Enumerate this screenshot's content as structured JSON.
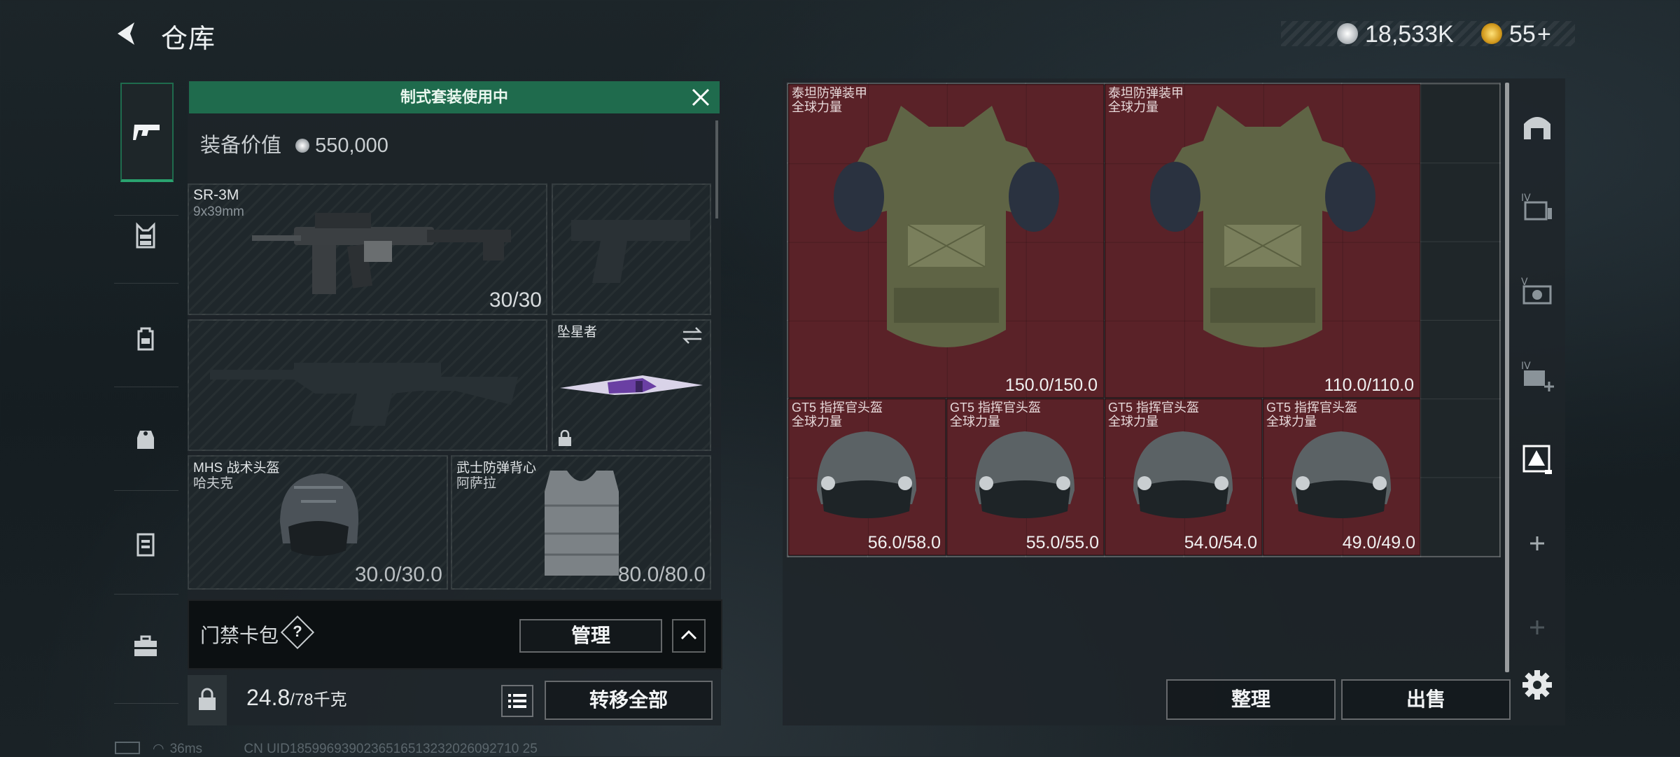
{
  "header": {
    "title": "仓库",
    "currency_primary": "18,533K",
    "currency_secondary": "55",
    "currency_secondary_plus": "+"
  },
  "sidebar": {
    "items": [
      {
        "icon": "gun-icon",
        "selected": true
      },
      {
        "icon": "vest-rig-icon"
      },
      {
        "icon": "backpack-icon"
      },
      {
        "icon": "pouch-icon"
      },
      {
        "icon": "container-icon"
      },
      {
        "icon": "briefcase-icon"
      }
    ]
  },
  "loadout": {
    "banner": "制式套装使用中",
    "value_label": "装备价值",
    "value": "550,000",
    "primary_weapon": {
      "name": "SR-3M",
      "ammo": "9x39mm",
      "mag": "30/30"
    },
    "melee": {
      "name": "坠星者"
    },
    "helmet": {
      "name": "MHS 战术头盔",
      "sub": "哈夫克",
      "durability": "30.0/30.0"
    },
    "armor": {
      "name": "武士防弹背心",
      "sub": "阿萨拉",
      "durability": "80.0/80.0"
    },
    "keycard": {
      "label": "门禁卡包",
      "help": "?",
      "manage": "管理"
    },
    "weight": {
      "current": "24.8",
      "max": "/78千克"
    },
    "transfer_all": "转移全部"
  },
  "stash": {
    "items": [
      {
        "name": "泰坦防弹装甲",
        "sub": "全球力量",
        "durability": "150.0/150.0"
      },
      {
        "name": "泰坦防弹装甲",
        "sub": "全球力量",
        "durability": "110.0/110.0"
      },
      {
        "name": "GT5 指挥官头盔",
        "sub": "全球力量",
        "durability": "56.0/58.0"
      },
      {
        "name": "GT5 指挥官头盔",
        "sub": "全球力量",
        "durability": "55.0/55.0"
      },
      {
        "name": "GT5 指挥官头盔",
        "sub": "全球力量",
        "durability": "54.0/54.0"
      },
      {
        "name": "GT5 指挥官头盔",
        "sub": "全球力量",
        "durability": "49.0/49.0"
      }
    ],
    "sort_label": "整理",
    "sell_label": "出售",
    "item_color": "#5a2228"
  },
  "tools": [
    "home-icon",
    "storage-iv-icon",
    "camera-v-icon",
    "storage-iv-plus-icon",
    "triangle-crate-icon",
    "plus-icon",
    "plus-icon",
    "gear-icon"
  ],
  "status": {
    "ping": "36ms",
    "uid": "CN UID1859969390236516513232026092710 25"
  }
}
